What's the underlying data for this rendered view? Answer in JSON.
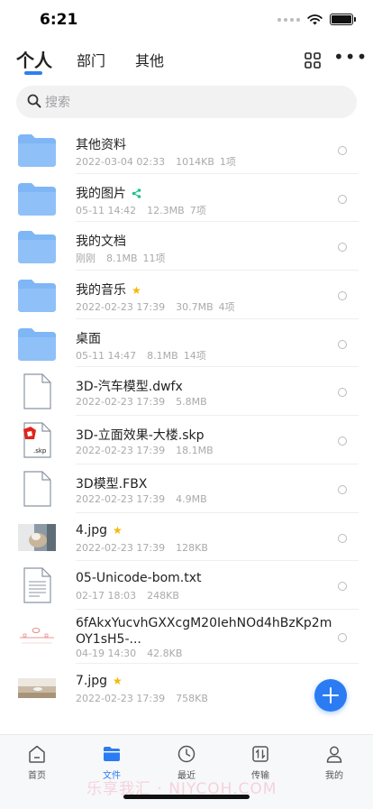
{
  "status_bar": {
    "time": "6:21"
  },
  "top_tabs": [
    {
      "label": "个人",
      "active": true
    },
    {
      "label": "部门",
      "active": false
    },
    {
      "label": "其他",
      "active": false
    }
  ],
  "toolbar": {
    "grid_icon": "grid-view-icon",
    "more_label": "•••"
  },
  "search": {
    "placeholder": "搜索"
  },
  "files": [
    {
      "name": "其他资料",
      "date": "2022-03-04 02:33",
      "size": "1014KB",
      "count": "1项",
      "type": "folder"
    },
    {
      "name": "我的图片",
      "date": "05-11 14:42",
      "size": "12.3MB",
      "count": "7项",
      "type": "folder",
      "badge": "share"
    },
    {
      "name": "我的文档",
      "date": "刚刚",
      "size": "8.1MB",
      "count": "11项",
      "type": "folder"
    },
    {
      "name": "我的音乐",
      "date": "2022-02-23 17:39",
      "size": "30.7MB",
      "count": "4项",
      "type": "folder",
      "badge": "star"
    },
    {
      "name": "桌面",
      "date": "05-11 14:47",
      "size": "8.1MB",
      "count": "14项",
      "type": "folder"
    },
    {
      "name": "3D-汽车模型.dwfx",
      "date": "2022-02-23 17:39",
      "size": "5.8MB",
      "type": "file-blank"
    },
    {
      "name": "3D-立面效果-大楼.skp",
      "date": "2022-02-23 17:39",
      "size": "18.1MB",
      "type": "file-skp",
      "ext": ".skp"
    },
    {
      "name": "3D模型.FBX",
      "date": "2022-02-23 17:39",
      "size": "4.9MB",
      "type": "file-blank"
    },
    {
      "name": "4.jpg",
      "date": "2022-02-23 17:39",
      "size": "128KB",
      "type": "image-cat",
      "badge": "star"
    },
    {
      "name": "05-Unicode-bom.txt",
      "date": "02-17 18:03",
      "size": "248KB",
      "type": "file-text"
    },
    {
      "name": "6fAkxYucvhGXXcgM20IehNOd4hBzKp2m",
      "name_line2": "OY1sH5-...",
      "date": "04-19 14:30",
      "size": "42.8KB",
      "type": "image-sketch"
    },
    {
      "name": "7.jpg",
      "date": "2022-02-23 17:39",
      "size": "758KB",
      "type": "image-beach",
      "badge": "star"
    }
  ],
  "bottom_nav": [
    {
      "label": "首页",
      "icon": "home-icon",
      "active": false
    },
    {
      "label": "文件",
      "icon": "folder-icon",
      "active": true
    },
    {
      "label": "最近",
      "icon": "clock-icon",
      "active": false
    },
    {
      "label": "传输",
      "icon": "transfer-icon",
      "active": false
    },
    {
      "label": "我的",
      "icon": "user-icon",
      "active": false
    }
  ],
  "watermark": "乐享我汇 · NJYCOH.COM",
  "colors": {
    "accent": "#2b7cf2",
    "folder": "#7fb6f6",
    "star": "#f5b800",
    "share": "#1ec28b"
  }
}
